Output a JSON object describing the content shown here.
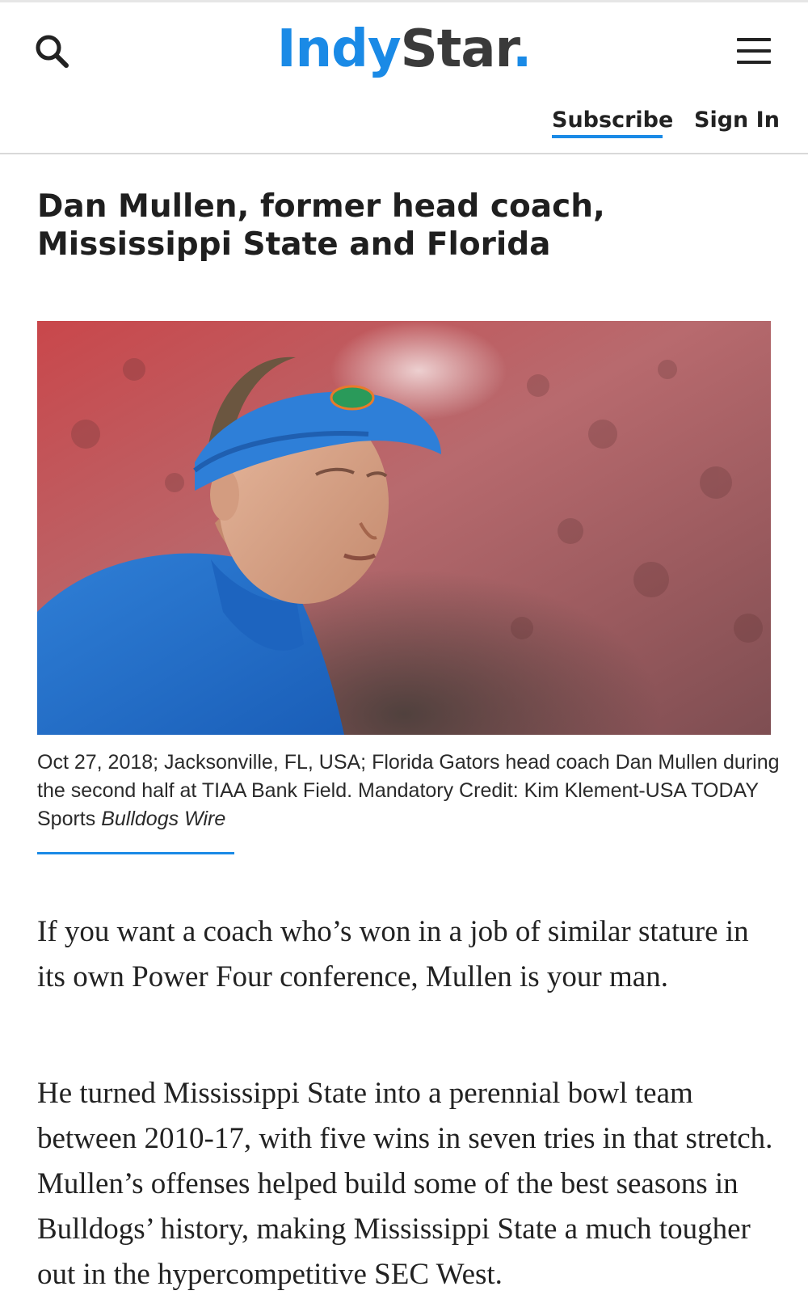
{
  "header": {
    "logo_main": "Indy",
    "logo_accent": "Star",
    "logo_dot": ".",
    "subscribe_label": "Subscribe",
    "signin_label": "Sign In"
  },
  "article": {
    "headline": "Dan Mullen, former head coach, Mississippi State and Florida",
    "caption": "Oct 27, 2018; Jacksonville, FL, USA; Florida Gators head coach Dan Mullen during the second half at TIAA Bank Field. Mandatory Credit: Kim Klement-USA TODAY Sports",
    "caption_credit": "Bulldogs Wire",
    "paragraphs": [
      "If you want a coach who’s won in a job of similar stature in its own Power Four conference, Mullen is your man.",
      "He turned Mississippi State into a perennial bowl team between 2010-17, with five wins in seven tries in that stretch. Mullen’s offenses helped build some of the best seasons in Bulldogs’ history, making Mississippi State a much tougher out in the hypercompetitive SEC West."
    ]
  },
  "icons": {
    "search": "search-icon",
    "menu": "hamburger-menu-icon"
  },
  "colors": {
    "accent": "#1a8ae6",
    "logo_dark": "#3a3a3a",
    "text": "#1f1f1f"
  }
}
